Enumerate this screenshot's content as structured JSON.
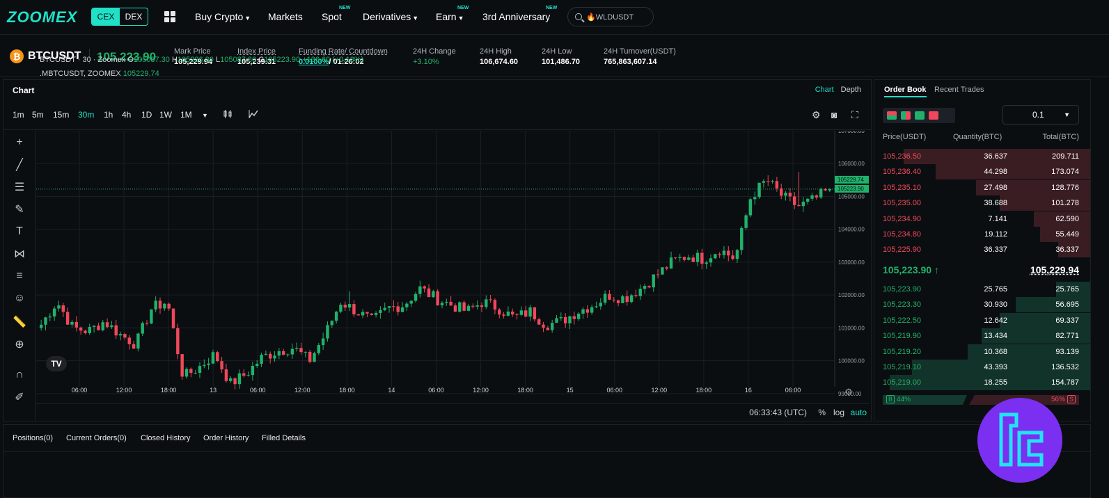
{
  "nav": {
    "logo": "ZOOMEX",
    "cex": "CEX",
    "dex": "DEX",
    "buy_crypto": "Buy Crypto",
    "markets": "Markets",
    "spot": "Spot",
    "derivatives": "Derivatives",
    "earn": "Earn",
    "anniversary": "3rd Anniversary",
    "new_badge": "NEW",
    "search_value": "WLDUSDT"
  },
  "ticker": {
    "symbol": "BTCUSDT",
    "last_price": "105,223.90",
    "mark_price_label": "Mark Price",
    "mark_price": "105,229.94",
    "index_price_label": "Index Price",
    "index_price": "105,239.31",
    "funding_label": "Funding Rate/ Countdown",
    "funding_rate": "0.0100%",
    "countdown": "/ 01:26:02",
    "change_label": "24H Change",
    "change": "+3.10%",
    "high_label": "24H High",
    "high": "106,674.60",
    "low_label": "24H Low",
    "low": "101,486.70",
    "turnover_label": "24H Turnover(USDT)",
    "turnover": "765,863,607.14"
  },
  "chart": {
    "title": "Chart",
    "tab_chart": "Chart",
    "tab_depth": "Depth",
    "timeframes": [
      "1m",
      "5m",
      "15m",
      "30m",
      "1h",
      "4h",
      "1D",
      "1W",
      "1M"
    ],
    "active_timeframe": "30m",
    "legend_symbol": "BTCUSDT · 30 · Zoomex",
    "legend_o_label": "O",
    "legend_o": "105087.30",
    "legend_h_label": "H",
    "legend_h": "105226.30",
    "legend_l_label": "L",
    "legend_l": "105087.30",
    "legend_c_label": "C",
    "legend_c": "105223.90",
    "legend_change": "+136.60 (+0.13%)",
    "mark_symbol": ".MBTCUSDT, ZOOMEX",
    "mark_value": "105229.74",
    "price_tag_mark": "105229.74",
    "price_tag_last": "105223.90",
    "clock": "06:33:43 (UTC)",
    "opt_percent": "%",
    "opt_log": "log",
    "opt_auto": "auto",
    "tv_logo": "TV"
  },
  "chart_data": {
    "type": "candlestick",
    "ylim": [
      98700,
      107000
    ],
    "y_ticks": [
      "107000.00",
      "106000.00",
      "105000.00",
      "104000.00",
      "103000.00",
      "102000.00",
      "101000.00",
      "100000.00",
      "99000.00"
    ],
    "x_ticks": [
      "06:00",
      "12:00",
      "18:00",
      "13",
      "06:00",
      "12:00",
      "18:00",
      "14",
      "06:00",
      "12:00",
      "18:00",
      "15",
      "06:00",
      "12:00",
      "18:00",
      "16",
      "06:00"
    ],
    "close_path": [
      101100,
      101800,
      101000,
      100900,
      101200,
      100800,
      100500,
      101600,
      101800,
      99500,
      99800,
      100200,
      99300,
      99600,
      100100,
      100300,
      100400,
      100000,
      100800,
      101800,
      101500,
      101200,
      101600,
      101700,
      102200,
      101900,
      101700,
      101500,
      101800,
      101600,
      101300,
      101500,
      101100,
      101200,
      101500,
      101700,
      102000,
      101900,
      102200,
      102600,
      103000,
      103200,
      103100,
      103400,
      103100,
      105000,
      105500,
      105000,
      104700,
      104900,
      105223.9
    ],
    "last": 105223.9
  },
  "orderbook": {
    "tab_book": "Order Book",
    "tab_trades": "Recent Trades",
    "precision": "0.1",
    "col_price": "Price(USDT)",
    "col_qty": "Quantity(BTC)",
    "col_total": "Total(BTC)",
    "asks": [
      {
        "price": "105,236.50",
        "qty": "36.637",
        "total": "209.711",
        "depth": 0.93
      },
      {
        "price": "105,236.40",
        "qty": "44.298",
        "total": "173.074",
        "depth": 0.77
      },
      {
        "price": "105,235.10",
        "qty": "27.498",
        "total": "128.776",
        "depth": 0.57
      },
      {
        "price": "105,235.00",
        "qty": "38.688",
        "total": "101.278",
        "depth": 0.45
      },
      {
        "price": "105,234.90",
        "qty": "7.141",
        "total": "62.590",
        "depth": 0.28
      },
      {
        "price": "105,234.80",
        "qty": "19.112",
        "total": "55.449",
        "depth": 0.25
      },
      {
        "price": "105,225.90",
        "qty": "36.337",
        "total": "36.337",
        "depth": 0.16
      }
    ],
    "mid_price": "105,223.90 ↑",
    "mark_price": "105,229.94",
    "bids": [
      {
        "price": "105,223.90",
        "qty": "25.765",
        "total": "25.765",
        "depth": 0.17
      },
      {
        "price": "105,223.30",
        "qty": "30.930",
        "total": "56.695",
        "depth": 0.37
      },
      {
        "price": "105,222.50",
        "qty": "12.642",
        "total": "69.337",
        "depth": 0.45
      },
      {
        "price": "105,219.90",
        "qty": "13.434",
        "total": "82.771",
        "depth": 0.54
      },
      {
        "price": "105,219.20",
        "qty": "10.368",
        "total": "93.139",
        "depth": 0.61
      },
      {
        "price": "105,219.10",
        "qty": "43.393",
        "total": "136.532",
        "depth": 0.89
      },
      {
        "price": "105,219.00",
        "qty": "18.255",
        "total": "154.787",
        "depth": 1.0
      }
    ],
    "buy_label": "B",
    "buy_ratio": "44%",
    "sell_ratio": "56%",
    "sell_label": "S"
  },
  "bottom": {
    "tabs": [
      "Positions(0)",
      "Current Orders(0)",
      "Closed History",
      "Order History",
      "Filled Details"
    ]
  },
  "colors": {
    "accent": "#20e1c8",
    "up": "#20b26c",
    "down": "#f0485a",
    "background": "#0b0e11"
  }
}
